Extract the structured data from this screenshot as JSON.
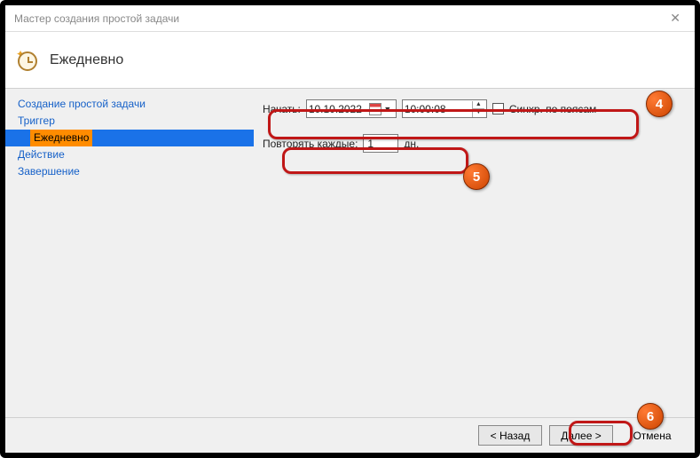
{
  "window": {
    "title": "Мастер создания простой задачи"
  },
  "header": {
    "title": "Ежедневно"
  },
  "sidebar": {
    "items": [
      {
        "label": "Создание простой задачи"
      },
      {
        "label": "Триггер"
      },
      {
        "label": "Ежедневно"
      },
      {
        "label": "Действие"
      },
      {
        "label": "Завершение"
      }
    ]
  },
  "form": {
    "start_label": "Начать:",
    "date_value": "10.10.2022",
    "time_value": "10:00:08",
    "sync_label": "Синхр. по поясам",
    "repeat_label": "Повторять каждые:",
    "repeat_value": "1",
    "repeat_unit": "дн."
  },
  "buttons": {
    "back": "< Назад",
    "next": "Далее >",
    "cancel": "Отмена"
  },
  "badges": {
    "b4": "4",
    "b5": "5",
    "b6": "6"
  }
}
